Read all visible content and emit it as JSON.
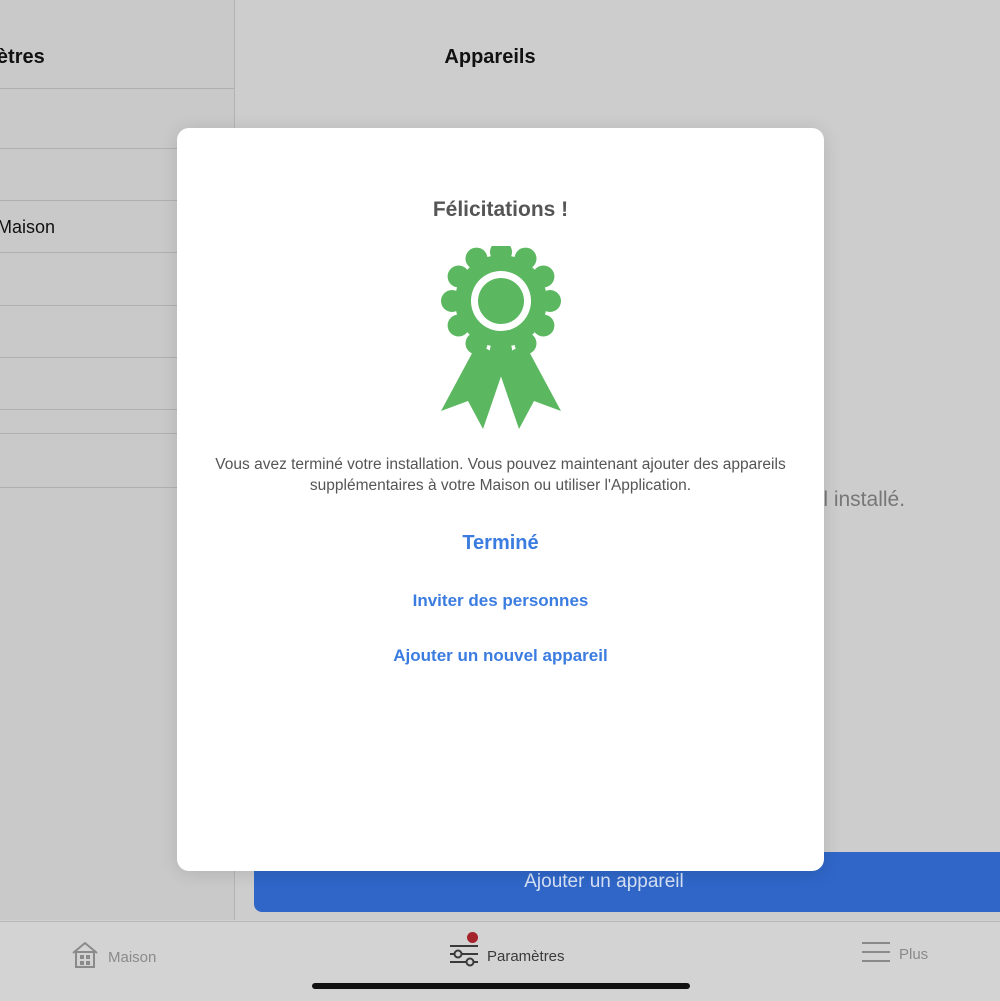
{
  "left_pane": {
    "title": "Paramètres",
    "title_visible": "amètres",
    "rows": [
      "",
      "",
      "Maison",
      "",
      "",
      "",
      "",
      ""
    ]
  },
  "right_pane": {
    "title": "Appareils",
    "empty_message_visible": "reil installé.",
    "add_button_label": "Ajouter un appareil"
  },
  "tabbar": {
    "tabs": [
      {
        "label": "Maison",
        "icon": "home-icon"
      },
      {
        "label": "Paramètres",
        "icon": "sliders-icon",
        "active": true
      },
      {
        "label": "Plus",
        "icon": "menu-icon"
      }
    ]
  },
  "modal": {
    "title": "Félicitations !",
    "icon": "award-ribbon-icon",
    "message": "Vous avez terminé votre installation. Vous pouvez maintenant ajouter des appareils supplémentaires à votre Maison ou utiliser l'Application.",
    "done_label": "Terminé",
    "invite_label": "Inviter des personnes",
    "add_device_label": "Ajouter un nouvel appareil"
  },
  "colors": {
    "accent": "#3b7ce0",
    "award_green": "#5cb860",
    "badge_red": "#a5232b",
    "primary_button": "#2f66c8"
  }
}
